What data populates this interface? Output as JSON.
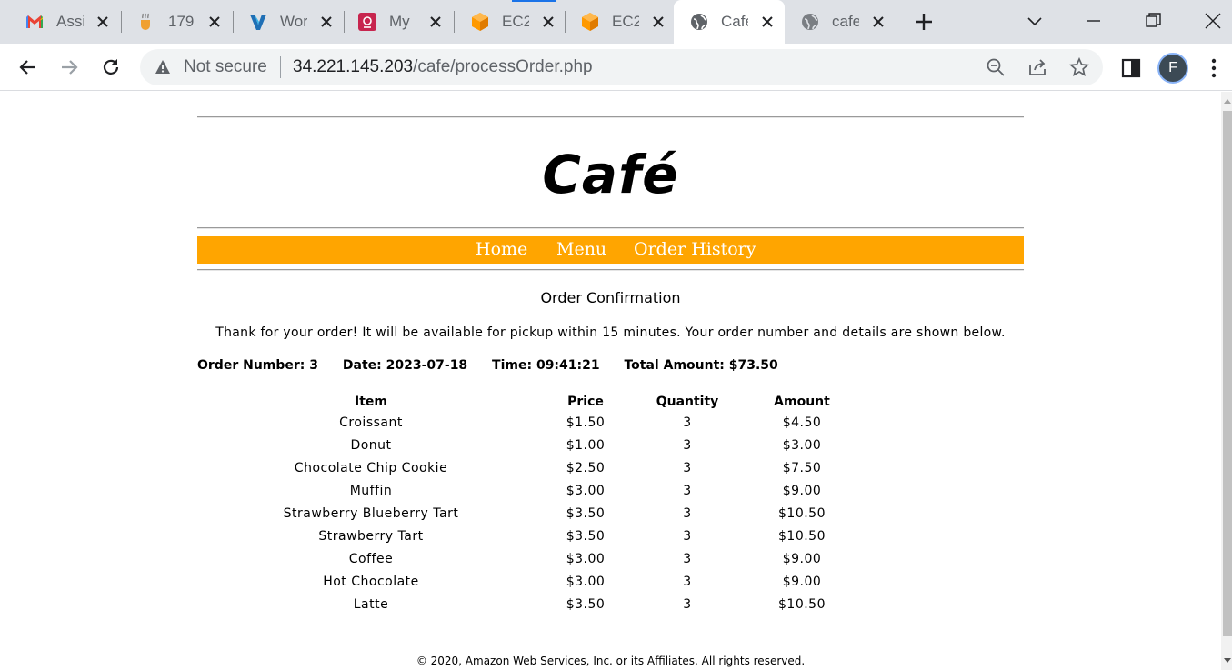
{
  "browser": {
    "tabs": [
      {
        "title": "Assi",
        "icon": "gmail-icon"
      },
      {
        "title": "179",
        "icon": "coffee-icon"
      },
      {
        "title": "Wor",
        "icon": "vocareum-icon"
      },
      {
        "title": "My",
        "icon": "aws-console-icon"
      },
      {
        "title": "EC2",
        "icon": "ec2-icon"
      },
      {
        "title": "EC2",
        "icon": "ec2-icon"
      },
      {
        "title": "Cafe",
        "icon": "globe-icon",
        "active": true
      },
      {
        "title": "cafe",
        "icon": "globe-icon"
      }
    ],
    "security_label": "Not secure",
    "url_host": "34.221.145.203",
    "url_path": "/cafe/processOrder.php",
    "profile_initial": "F",
    "accent_color": "#1a73e8"
  },
  "site": {
    "title": "Café",
    "nav": [
      "Home",
      "Menu",
      "Order History"
    ],
    "nav_color": "#ffa500"
  },
  "order": {
    "heading": "Order Confirmation",
    "thanks": "Thank for your order! It will be available for pickup within 15 minutes. Your order number and details are shown below.",
    "number_label": "Order Number: 3",
    "date_label": "Date: 2023-07-18",
    "time_label": "Time: 09:41:21",
    "total_label": "Total Amount: $73.50",
    "columns": [
      "Item",
      "Price",
      "Quantity",
      "Amount"
    ],
    "items": [
      {
        "item": "Croissant",
        "price": "$1.50",
        "quantity": "3",
        "amount": "$4.50"
      },
      {
        "item": "Donut",
        "price": "$1.00",
        "quantity": "3",
        "amount": "$3.00"
      },
      {
        "item": "Chocolate Chip Cookie",
        "price": "$2.50",
        "quantity": "3",
        "amount": "$7.50"
      },
      {
        "item": "Muffin",
        "price": "$3.00",
        "quantity": "3",
        "amount": "$9.00"
      },
      {
        "item": "Strawberry Blueberry Tart",
        "price": "$3.50",
        "quantity": "3",
        "amount": "$10.50"
      },
      {
        "item": "Strawberry Tart",
        "price": "$3.50",
        "quantity": "3",
        "amount": "$10.50"
      },
      {
        "item": "Coffee",
        "price": "$3.00",
        "quantity": "3",
        "amount": "$9.00"
      },
      {
        "item": "Hot Chocolate",
        "price": "$3.00",
        "quantity": "3",
        "amount": "$9.00"
      },
      {
        "item": "Latte",
        "price": "$3.50",
        "quantity": "3",
        "amount": "$10.50"
      }
    ]
  },
  "footer": "© 2020, Amazon Web Services, Inc. or its Affiliates. All rights reserved."
}
